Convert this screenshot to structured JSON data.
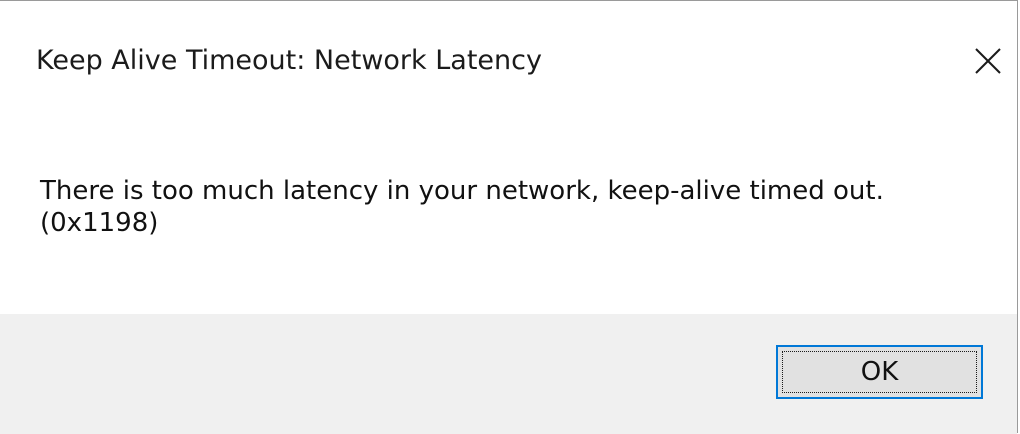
{
  "dialog": {
    "title": "Keep Alive Timeout: Network Latency",
    "close_icon": "close-icon",
    "message": "There is too much latency in your network, keep-alive timed out.(0x1198)",
    "ok_label": "OK"
  },
  "colors": {
    "footer_background": "#f0f0f0",
    "button_background": "#e1e1e1",
    "button_focus_border": "#0078d7"
  }
}
